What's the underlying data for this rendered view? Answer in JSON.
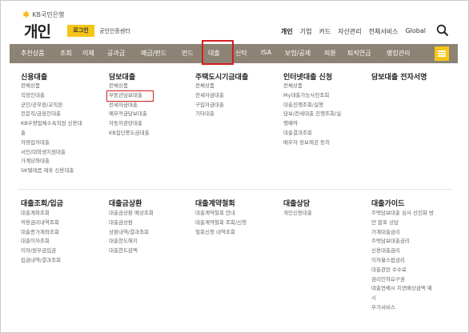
{
  "brand": {
    "bank_name": "KB국민은행",
    "title": "개인"
  },
  "header": {
    "login_label": "로그인",
    "cert_center_label": "공인인증센터",
    "top_nav": [
      "개인",
      "기업",
      "카드",
      "자산관리",
      "전체서비스",
      "Global"
    ]
  },
  "menubar": {
    "items": [
      "추천상품",
      "조회",
      "이체",
      "공과금",
      "예금/펀드",
      "펀드",
      "대출",
      "신탁",
      "ISA",
      "보험/공제",
      "외환",
      "퇴직연금",
      "뱅킹관리"
    ],
    "active_index": 6
  },
  "colors": {
    "menubar_bg": "#8d8375",
    "accent": "#f5c518",
    "highlight": "#d21f1f"
  },
  "columns_top": [
    {
      "title": "신용대출",
      "items": [
        "전체상품",
        "직장인대출",
        "군인/공무원/교직원",
        "전문직/금융인대출",
        "KB우량업체소속직원 신용대",
        "출",
        "자영업자대출",
        "서민/대학생지원대출",
        "가계당좌대출",
        "SK텔레콤 제휴 신용대출"
      ]
    },
    {
      "title": "담보대출",
      "items": [
        "전체상품",
        "부동산담보대출",
        "전세자금대출",
        "예부적금담보대출",
        "자동차관련대출",
        "KB집단중도금대출"
      ]
    },
    {
      "title": "주택도시기금대출",
      "items": [
        "전체상품",
        "전세자금대출",
        "구입자금대출",
        "기타대출"
      ]
    },
    {
      "title": "인터넷대출 신청",
      "items": [
        "전체상품",
        "My대출가능사전조회",
        "대출진행조회/실행",
        "담보/전세대출 진행조회/실",
        "행예약",
        "대출결과조회",
        "배우자 정보제공 동의"
      ]
    },
    {
      "title": "담보대출 전자서명",
      "items": []
    }
  ],
  "columns_bottom": [
    {
      "title": "대출조회/입금",
      "items": [
        "대출계좌조회",
        "적용금리내역조회",
        "대출증가계좌조회",
        "대출이자조회",
        "이자/원부금입금",
        "입금내역/결과조회"
      ]
    },
    {
      "title": "대출금상환",
      "items": [
        "대출금상환 예상조회",
        "대출금상환",
        "상환내역/결과조회",
        "대출한도해지",
        "대출한도감액"
      ]
    },
    {
      "title": "대출계약철회",
      "items": [
        "대출계약철회 안내",
        "대출계약철회 조회/신청",
        "철회신청 내역조회"
      ]
    },
    {
      "title": "대출상담",
      "items": [
        "개인신용대출"
      ]
    },
    {
      "title": "대출가이드",
      "items": [
        "주택담보대출 심사 선진화 방",
        "안 말표 상담",
        "가계대출금리",
        "주택담보대출금리",
        "신용대출금리",
        "이자율스왑금리",
        "대출관련 수수료",
        "금리인하요구권",
        "대출연체시 지연배상금액 예",
        "시",
        "부가서비스"
      ]
    }
  ]
}
